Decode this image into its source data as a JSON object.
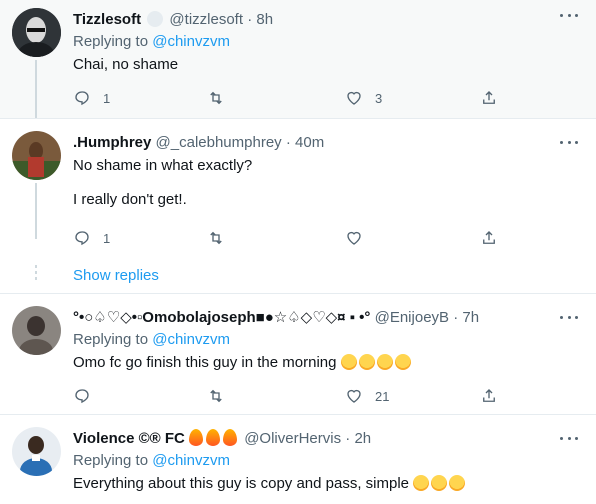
{
  "tweets": [
    {
      "name": "Tizzlesoft",
      "handle": "@tizzlesoft",
      "time": "8h",
      "replying_prefix": "Replying to",
      "replying_to": "@chinvzvm",
      "text": "Chai, no shame",
      "reply_count": "1",
      "retweet_count": "",
      "like_count": "3"
    },
    {
      "name": ".Humphrey",
      "handle": "@_calebhumphrey",
      "time": "40m",
      "text_line1": "No shame in what exactly?",
      "text_line2": "I really don't get!.",
      "reply_count": "1",
      "retweet_count": "",
      "like_count": ""
    },
    {
      "name": "°•○♤♡◇•▫Omobolajoseph■●☆♤◇♡◇¤ ▪ •°",
      "handle": "@EnijoeyB",
      "time": "7h",
      "replying_prefix": "Replying to",
      "replying_to": "@chinvzvm",
      "text": "Omo fc go finish this guy in the morning",
      "emoji_name": "tears-of-joy",
      "reply_count": "",
      "retweet_count": "",
      "like_count": "21"
    },
    {
      "name": "Violence ©® FC",
      "handle": "@OliverHervis",
      "time": "2h",
      "replying_prefix": "Replying to",
      "replying_to": "@chinvzvm",
      "text": "Everything about this guy is copy and pass, simple",
      "emoji_name": "rolling-on-floor-laughing"
    }
  ],
  "show_replies": "Show replies",
  "sep": "·",
  "colors": {
    "accent": "#1d9bf0",
    "muted": "#536471",
    "highlight_bg": "#f7f9f9"
  }
}
